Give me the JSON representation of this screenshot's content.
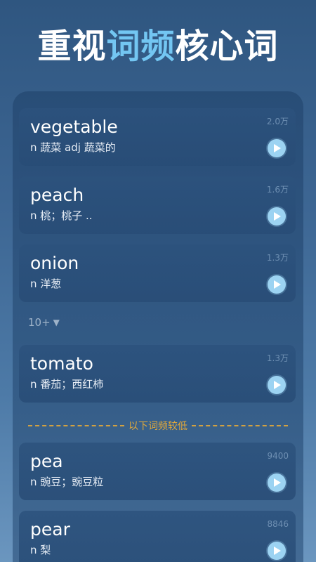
{
  "headline": {
    "part1": "重视",
    "highlight": "词频",
    "part2": "核心词"
  },
  "words": [
    {
      "word": "vegetable",
      "meaning": "n 蔬菜 adj 蔬菜的",
      "freq": "2.0万"
    },
    {
      "word": "peach",
      "meaning": "n 桃；桃子 ..",
      "freq": "1.6万"
    },
    {
      "word": "onion",
      "meaning": "n 洋葱",
      "freq": "1.3万"
    },
    {
      "word": "tomato",
      "meaning": "n 番茄；西红柿",
      "freq": "1.3万"
    },
    {
      "word": "pea",
      "meaning": "n 豌豆；豌豆粒",
      "freq": "9400"
    },
    {
      "word": "pear",
      "meaning": "n 梨",
      "freq": "8846"
    }
  ],
  "more": {
    "label": "10+",
    "icon": "triangle-down-icon"
  },
  "divider": {
    "label": "以下词频较低",
    "color": "#e2a93a"
  },
  "colors": {
    "accent": "#73c6f2",
    "play_button": "#9cd3f2"
  }
}
